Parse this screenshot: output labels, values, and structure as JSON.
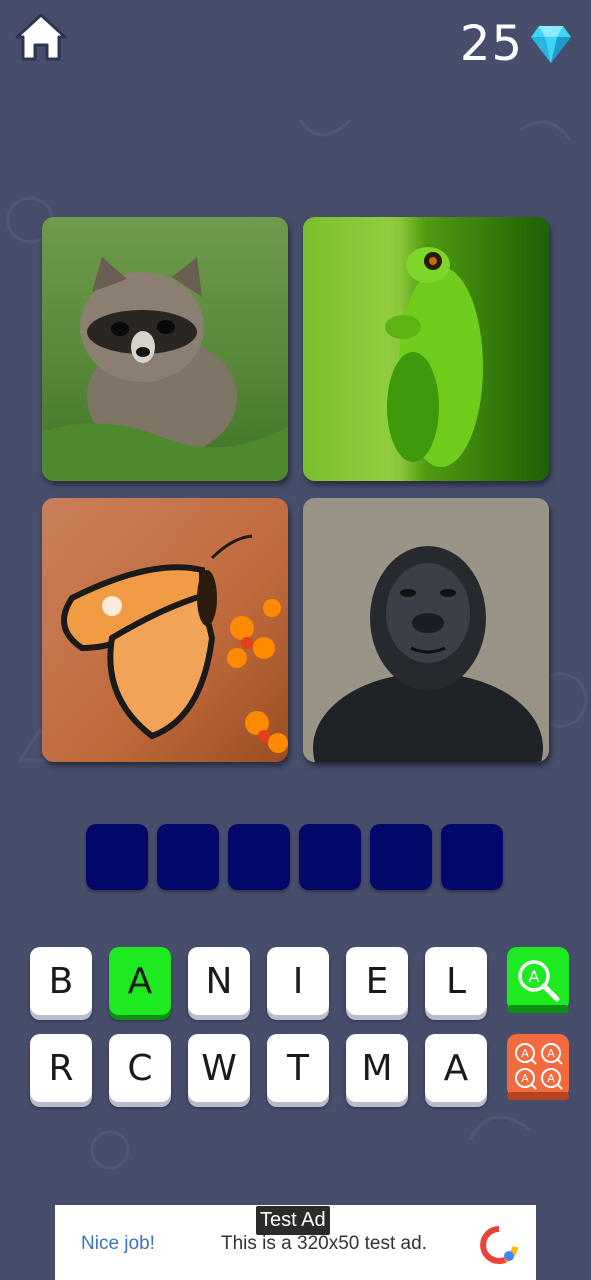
{
  "header": {
    "home_icon": "home-icon",
    "coin_count": "25",
    "gem_icon": "diamond-icon",
    "gem_color": "#3fd6f5"
  },
  "puzzle": {
    "images": [
      {
        "subject": "raccoon"
      },
      {
        "subject": "frog"
      },
      {
        "subject": "butterfly"
      },
      {
        "subject": "gorilla"
      }
    ],
    "answer_length": 6,
    "slot_color": "#03086a"
  },
  "keyboard": {
    "row1": [
      "B",
      "A",
      "N",
      "I",
      "E",
      "L"
    ],
    "row2": [
      "R",
      "C",
      "W",
      "T",
      "M",
      "A"
    ],
    "highlighted_index": 1,
    "highlight_color": "#1eea22",
    "tools": {
      "reveal_letter_icon": "magnifier-letter-icon",
      "reveal_color": "#1eea22",
      "remove_letters_icon": "quad-letter-icon",
      "remove_color": "#f36a3e"
    }
  },
  "ad": {
    "tag": "Test Ad",
    "nice": "Nice job!",
    "text": "This is a 320x50 test ad."
  }
}
